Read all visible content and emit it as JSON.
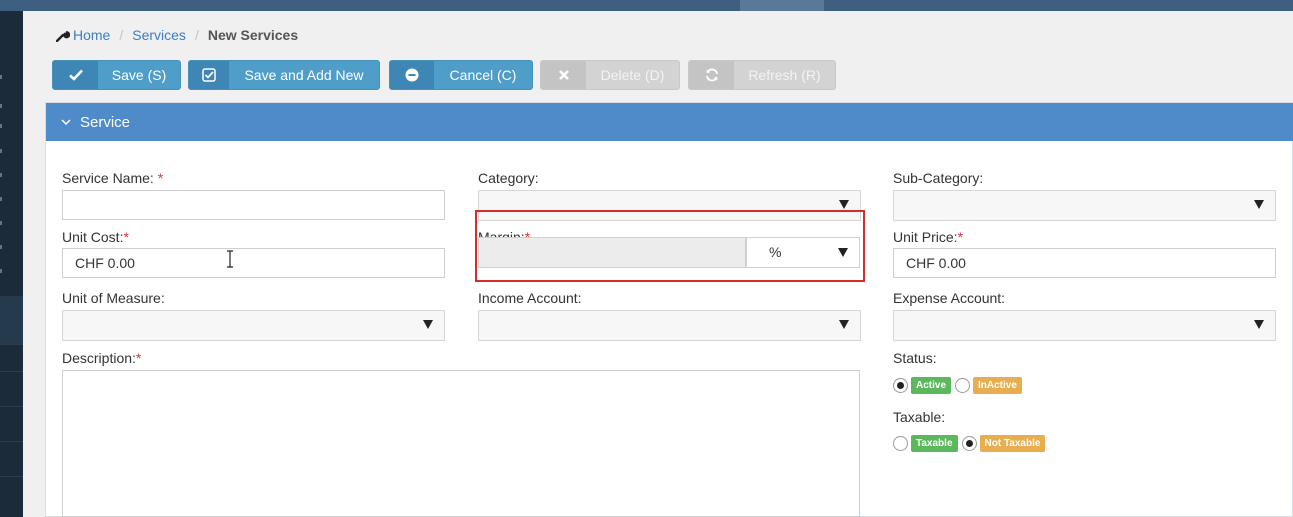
{
  "breadcrumb": {
    "home": "Home",
    "services": "Services",
    "current": "New Services",
    "separator": "/"
  },
  "toolbar": {
    "save": "Save (S)",
    "save_add": "Save and Add New",
    "cancel": "Cancel (C)",
    "delete": "Delete (D)",
    "refresh": "Refresh (R)"
  },
  "panel": {
    "title": "Service"
  },
  "fields": {
    "service_name": {
      "label": "Service Name: ",
      "required": "*",
      "value": ""
    },
    "category": {
      "label": "Category:",
      "value": ""
    },
    "sub_category": {
      "label": "Sub-Category:",
      "value": ""
    },
    "unit_cost": {
      "label": "Unit Cost:",
      "required": "*",
      "value": "CHF 0.00"
    },
    "margin": {
      "label": "Margin:",
      "required": "*",
      "value": "",
      "unit": "%"
    },
    "unit_price": {
      "label": "Unit Price:",
      "required": "*",
      "value": "CHF 0.00"
    },
    "unit_of_measure": {
      "label": "Unit of Measure:",
      "value": ""
    },
    "income_account": {
      "label": "Income Account:",
      "value": ""
    },
    "expense_account": {
      "label": "Expense Account:",
      "value": ""
    },
    "description": {
      "label": "Description:",
      "required": "*",
      "value": ""
    },
    "status": {
      "label": "Status:",
      "options": [
        {
          "label": "Active",
          "checked": true,
          "color": "#5cb85c"
        },
        {
          "label": "InActive",
          "checked": false,
          "color": "#e8ad4f"
        }
      ]
    },
    "taxable": {
      "label": "Taxable:",
      "options": [
        {
          "label": "Taxable",
          "checked": false,
          "color": "#5cb85c"
        },
        {
          "label": "Not Taxable",
          "checked": true,
          "color": "#e8ad4f"
        }
      ]
    }
  },
  "colors": {
    "primary": "#4f9dc9",
    "header": "#4f8bc9",
    "required": "#d33",
    "highlight": "#d62b2b"
  },
  "icons": {
    "home": "wrench-icon",
    "save": "check-icon",
    "save_add": "check-square-icon",
    "cancel": "minus-circle-icon",
    "delete": "close-icon",
    "refresh": "refresh-icon",
    "panel": "chevron-down-icon",
    "select": "caret-down-icon"
  }
}
